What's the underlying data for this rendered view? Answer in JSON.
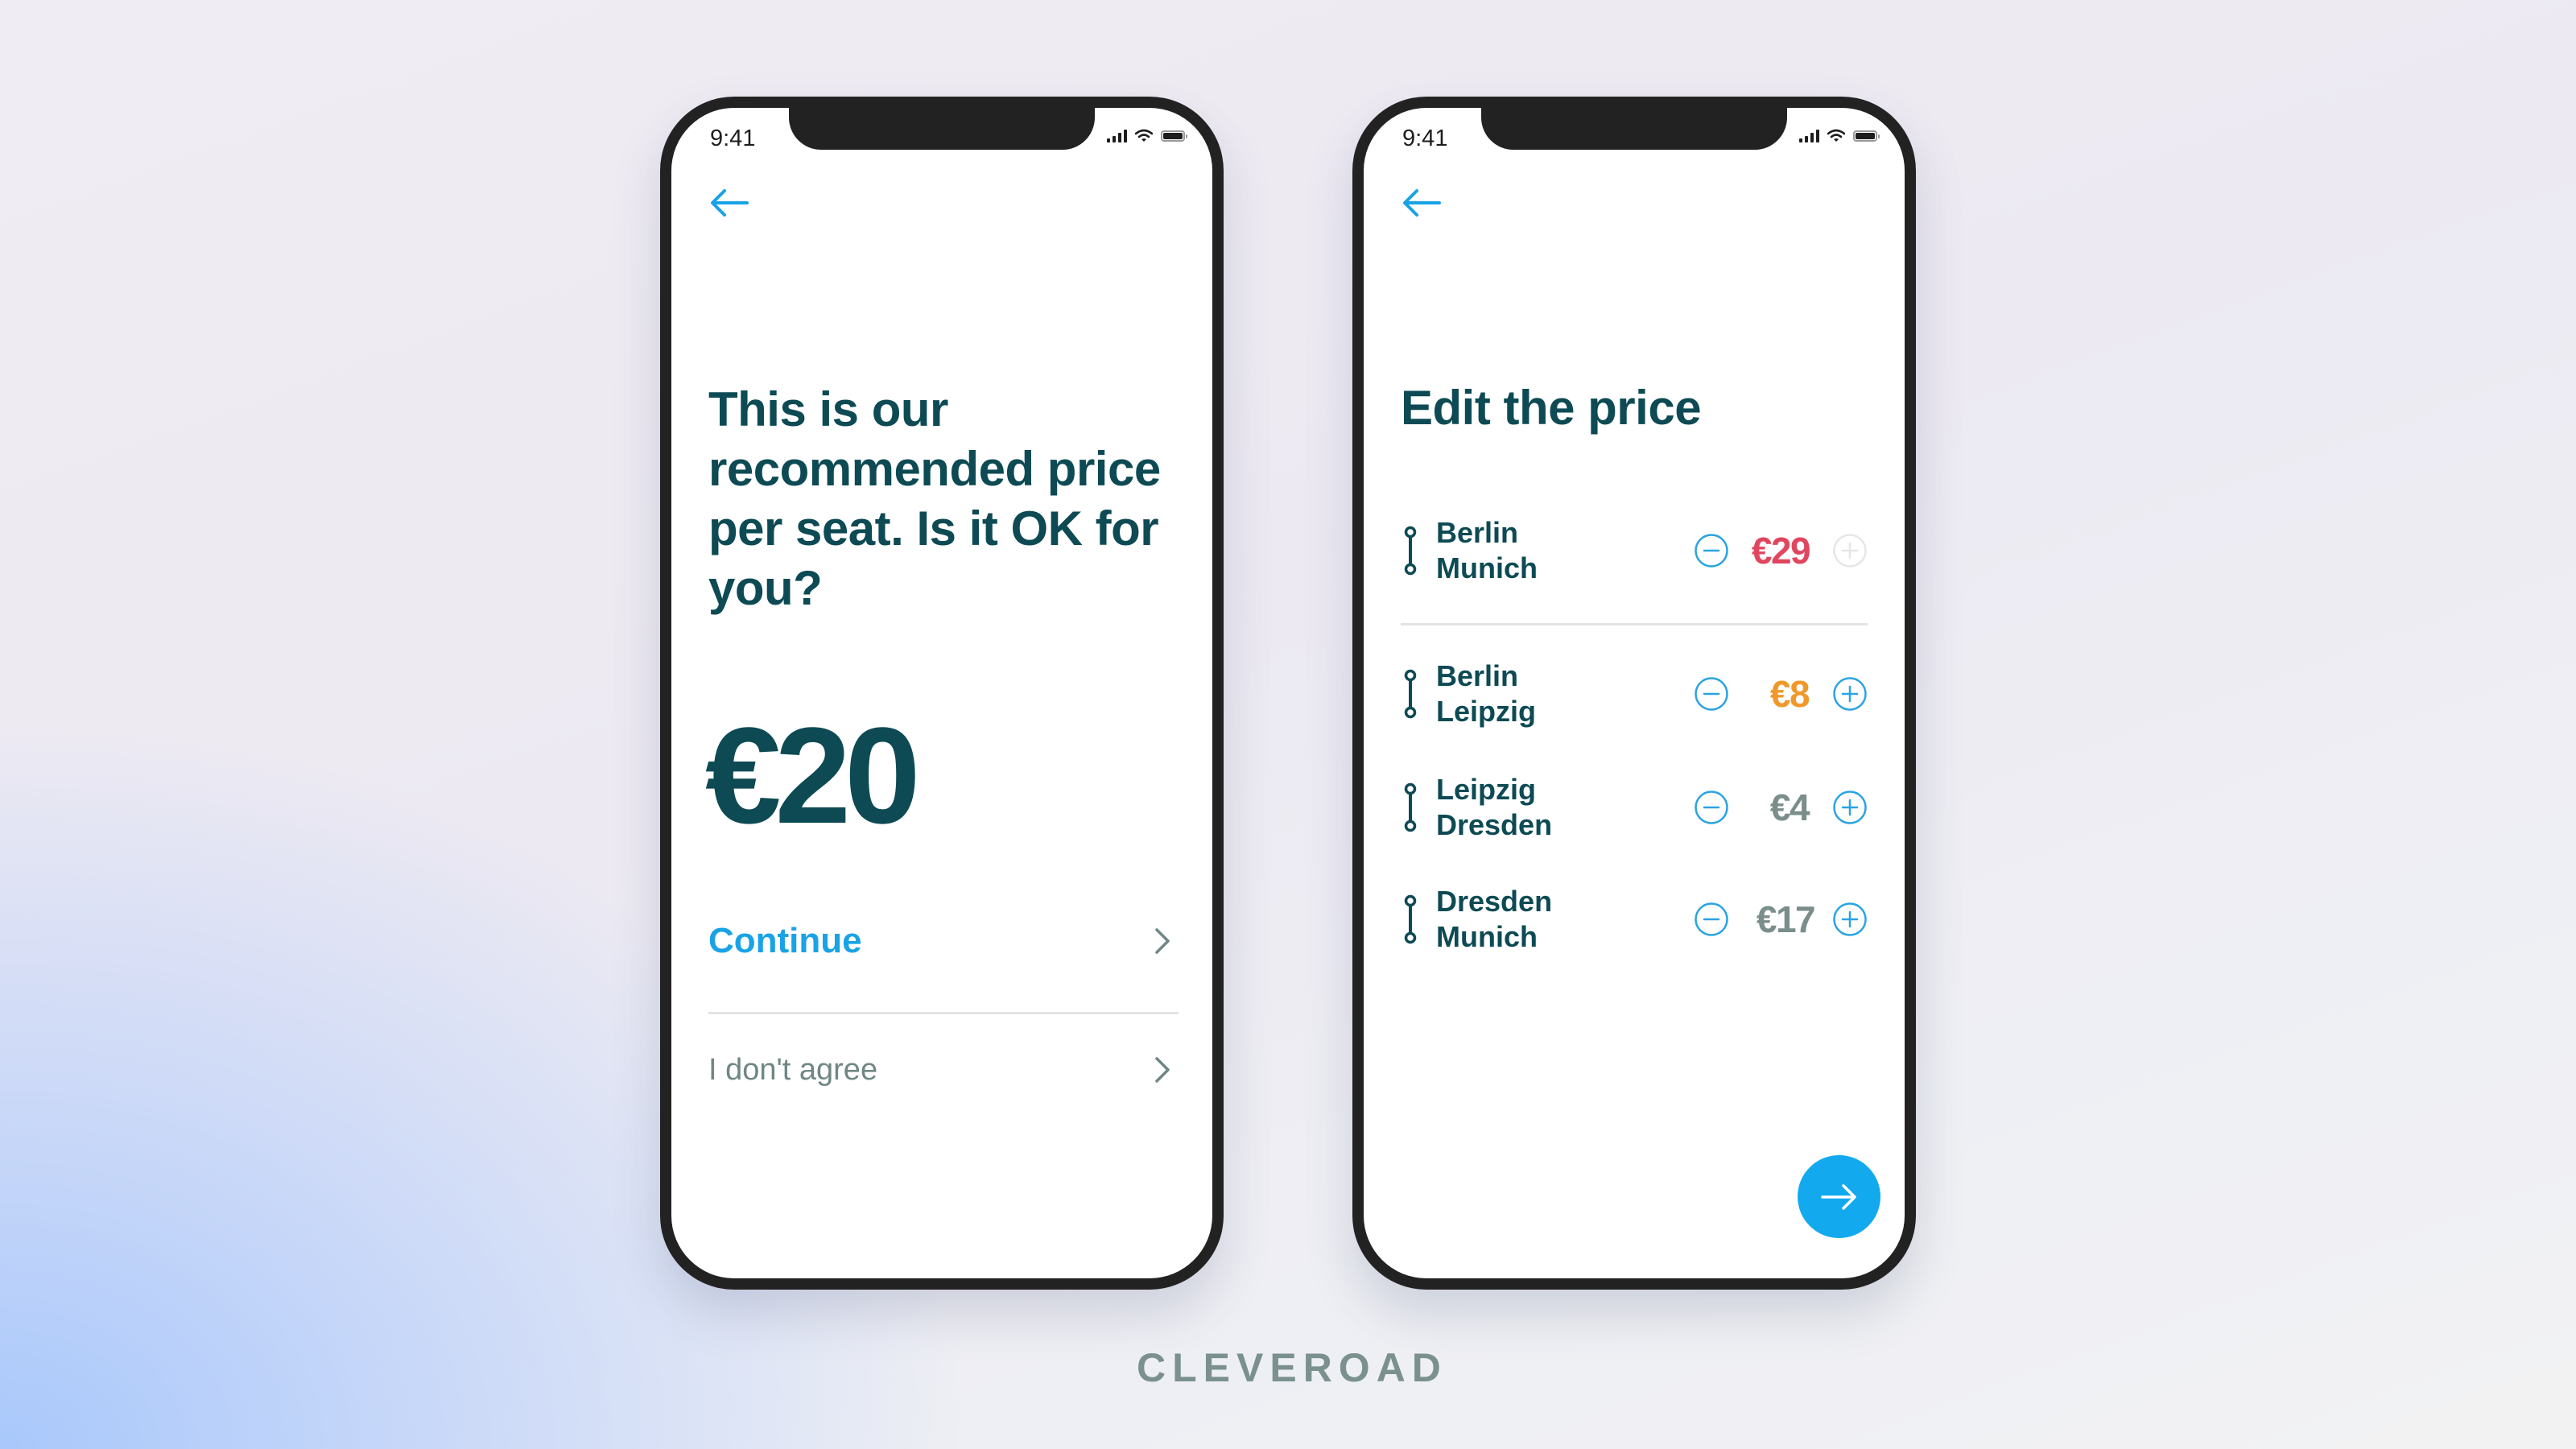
{
  "colors": {
    "accent": "#19a3e6",
    "fab": "#13a9ee",
    "heading": "#0d4a54",
    "muted": "#6f8784",
    "price_high": "#e0475f",
    "price_medium": "#f0992b",
    "price_normal": "#7a8e8b",
    "stepper_active": "#2aa3e2",
    "stepper_disabled": "#e6e6e6",
    "brand": "#7a918e"
  },
  "status_bar": {
    "time": "9:41",
    "icons": [
      "cellular-signal-icon",
      "wifi-icon",
      "battery-icon"
    ]
  },
  "screen_recommend": {
    "back_icon": "arrow-left-icon",
    "heading": "This is our recommended price per seat. Is it OK for you?",
    "price": "€20",
    "options": [
      {
        "label": "Continue",
        "icon": "chevron-right-icon"
      },
      {
        "label": "I don't agree",
        "icon": "chevron-right-icon"
      }
    ]
  },
  "screen_edit": {
    "back_icon": "arrow-left-icon",
    "title": "Edit the price",
    "routes": [
      {
        "from": "Berlin",
        "to": "Munich",
        "price": "€29",
        "price_level": "high",
        "minus_enabled": true,
        "plus_enabled": false
      },
      {
        "from": "Berlin",
        "to": "Leipzig",
        "price": "€8",
        "price_level": "medium",
        "minus_enabled": true,
        "plus_enabled": true
      },
      {
        "from": "Leipzig",
        "to": "Dresden",
        "price": "€4",
        "price_level": "normal",
        "minus_enabled": true,
        "plus_enabled": true
      },
      {
        "from": "Dresden",
        "to": "Munich",
        "price": "€17",
        "price_level": "normal",
        "minus_enabled": true,
        "plus_enabled": true
      }
    ],
    "next_button_icon": "arrow-right-icon"
  },
  "brand": {
    "name": "CLEVEROAD"
  }
}
